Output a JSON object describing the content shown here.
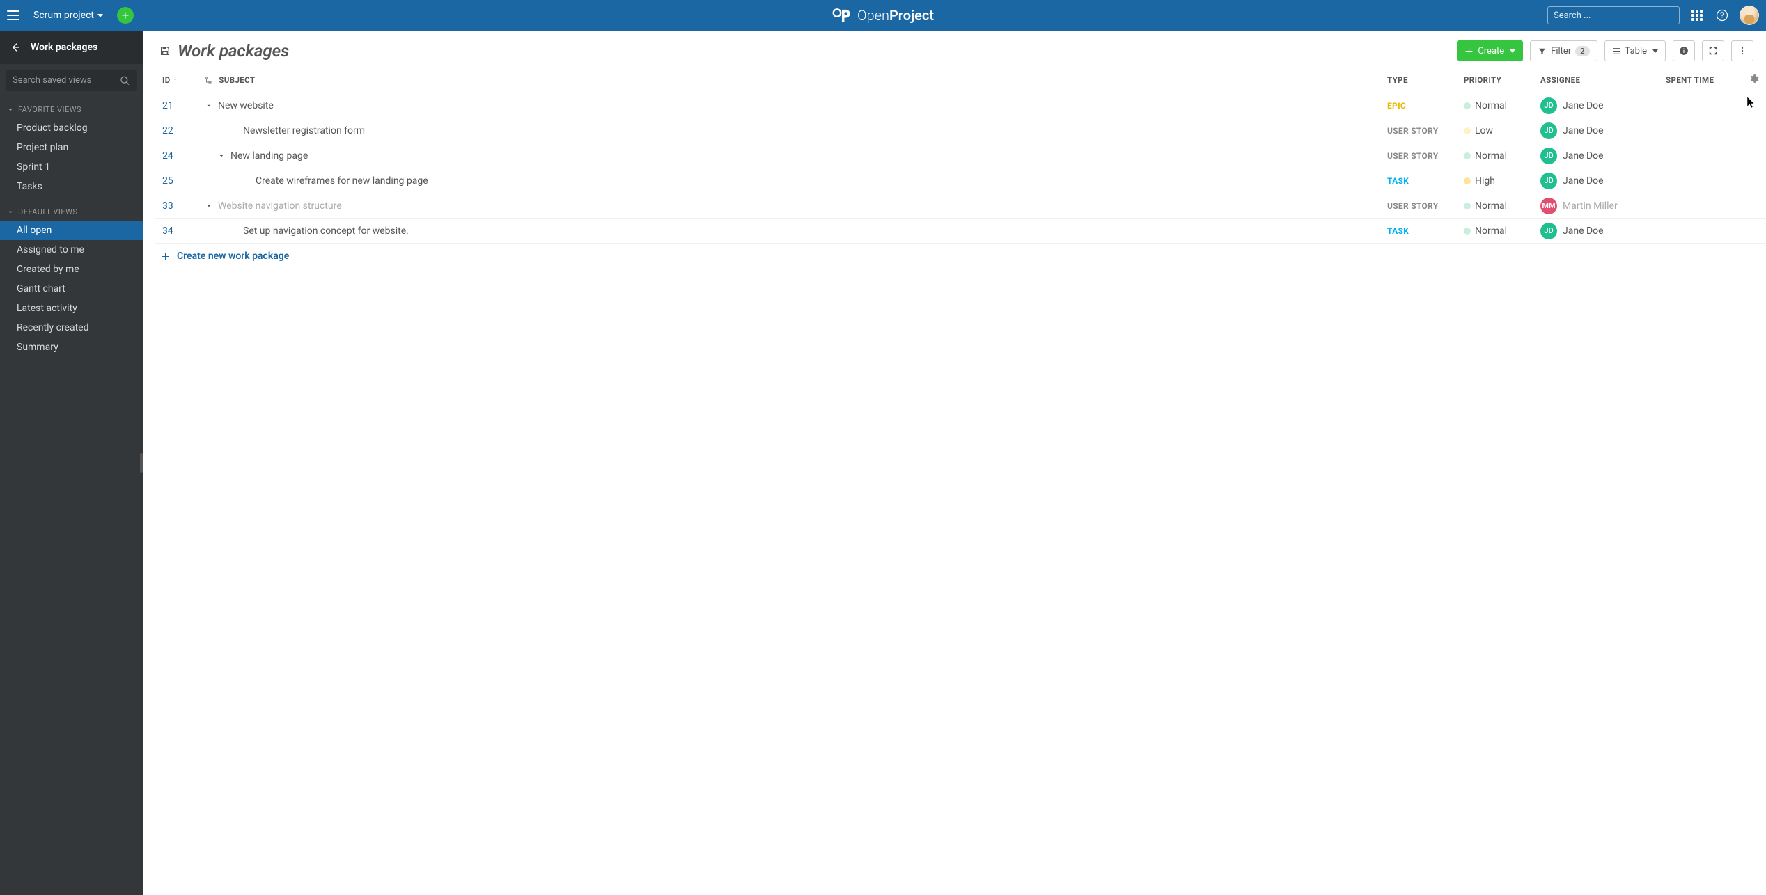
{
  "header": {
    "project_name": "Scrum project",
    "app_name_prefix": "Open",
    "app_name_suffix": "Project",
    "search_placeholder": "Search ..."
  },
  "sidebar": {
    "title": "Work packages",
    "search_placeholder": "Search saved views",
    "sections": [
      {
        "label": "Favorite Views",
        "items": [
          {
            "label": "Product backlog"
          },
          {
            "label": "Project plan"
          },
          {
            "label": "Sprint 1"
          },
          {
            "label": "Tasks"
          }
        ]
      },
      {
        "label": "Default Views",
        "items": [
          {
            "label": "All open",
            "active": true
          },
          {
            "label": "Assigned to me"
          },
          {
            "label": "Created by me"
          },
          {
            "label": "Gantt chart"
          },
          {
            "label": "Latest activity"
          },
          {
            "label": "Recently created"
          },
          {
            "label": "Summary"
          }
        ]
      }
    ]
  },
  "toolbar": {
    "page_title": "Work packages",
    "create_label": "Create",
    "filter_label": "Filter",
    "filter_count": "2",
    "view_label": "Table"
  },
  "table": {
    "columns": {
      "id": "ID",
      "subject": "SUBJECT",
      "type": "TYPE",
      "priority": "PRIORITY",
      "assignee": "ASSIGNEE",
      "spent_time": "SPENT TIME"
    },
    "rows": [
      {
        "id": "21",
        "indent": 0,
        "expand": true,
        "subject": "New website",
        "type": "EPIC",
        "priority": "Normal",
        "prio_dot": "normal",
        "assignee": "Jane Doe",
        "initials": "JD",
        "av": "jd"
      },
      {
        "id": "22",
        "indent": 2,
        "subject": "Newsletter registration form",
        "type": "USER STORY",
        "priority": "Low",
        "prio_dot": "low",
        "assignee": "Jane Doe",
        "initials": "JD",
        "av": "jd"
      },
      {
        "id": "24",
        "indent": 1,
        "expand": true,
        "subject": "New landing page",
        "type": "USER STORY",
        "priority": "Normal",
        "prio_dot": "normal",
        "assignee": "Jane Doe",
        "initials": "JD",
        "av": "jd"
      },
      {
        "id": "25",
        "indent": 3,
        "subject": "Create wireframes for new landing page",
        "type": "TASK",
        "priority": "High",
        "prio_dot": "high",
        "assignee": "Jane Doe",
        "initials": "JD",
        "av": "jd"
      },
      {
        "id": "33",
        "indent": 0,
        "expand": true,
        "muted": true,
        "subject": "Website navigation structure",
        "type": "USER STORY",
        "priority": "Normal",
        "prio_dot": "normal",
        "assignee": "Martin Miller",
        "initials": "MM",
        "av": "mm"
      },
      {
        "id": "34",
        "indent": 2,
        "subject": "Set up navigation concept for website.",
        "type": "TASK",
        "priority": "Normal",
        "prio_dot": "normal",
        "assignee": "Jane Doe",
        "initials": "JD",
        "av": "jd"
      }
    ],
    "create_label": "Create new work package"
  }
}
